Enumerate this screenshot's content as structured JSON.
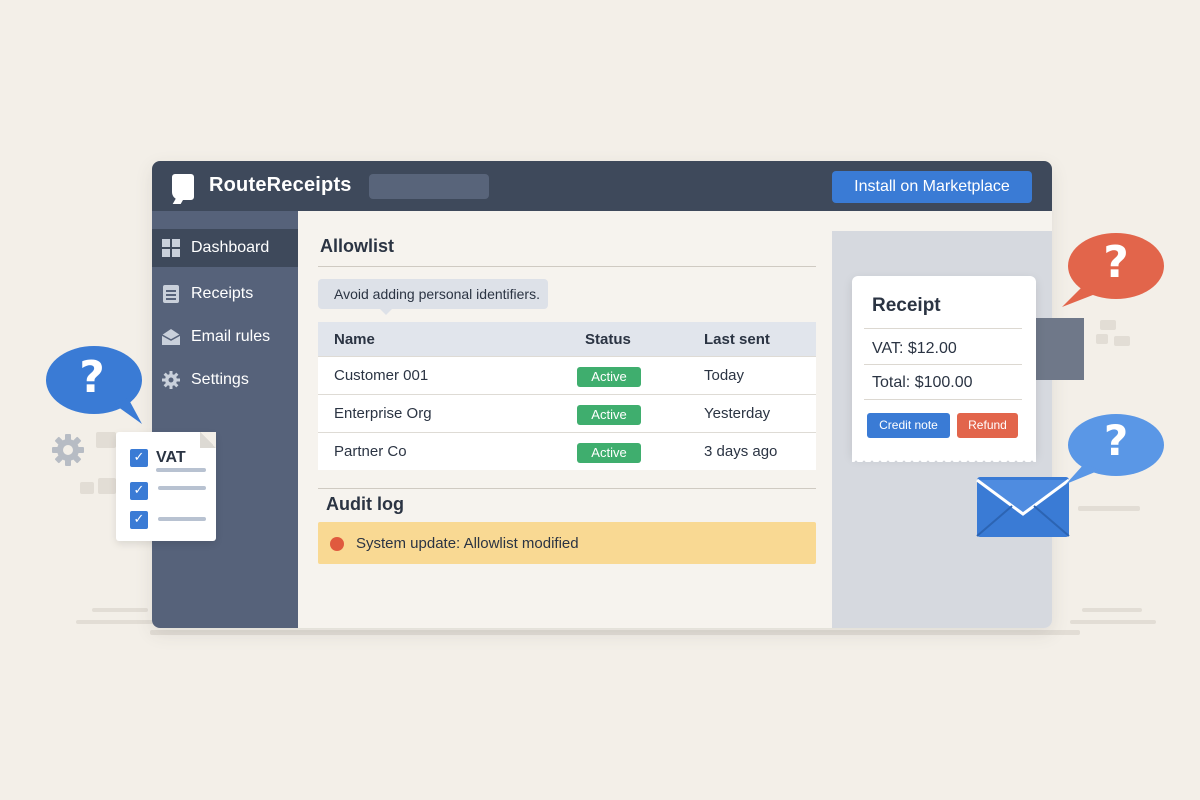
{
  "app": {
    "title": "RouteReceipts",
    "install_label": "Install on Marketplace"
  },
  "sidebar": {
    "items": [
      {
        "label": "Dashboard",
        "icon": "grid-icon",
        "active": true
      },
      {
        "label": "Receipts",
        "icon": "document-icon",
        "active": false
      },
      {
        "label": "Email rules",
        "icon": "inbox-icon",
        "active": false
      },
      {
        "label": "Settings",
        "icon": "gear-icon",
        "active": false
      }
    ]
  },
  "allowlist": {
    "title": "Allowlist",
    "hint": "Avoid adding personal identifiers.",
    "columns": [
      "Name",
      "Status",
      "Last sent"
    ],
    "rows": [
      {
        "name": "Customer 001",
        "status": "Active",
        "last_sent": "Today"
      },
      {
        "name": "Enterprise Org",
        "status": "Active",
        "last_sent": "Yesterday"
      },
      {
        "name": "Partner Co",
        "status": "Active",
        "last_sent": "3 days ago"
      }
    ]
  },
  "audit": {
    "title": "Audit log",
    "entry": "System update: Allowlist modified"
  },
  "receipt": {
    "title": "Receipt",
    "vat": "VAT: $12.00",
    "total": "Total: $100.00",
    "credit_label": "Credit note",
    "refund_label": "Refund"
  },
  "checklist": {
    "label": "VAT"
  },
  "bubbles": [
    "?",
    "?",
    "?"
  ],
  "colors": {
    "topbar": "#3e495b",
    "sidebar": "#56627a",
    "accent_blue": "#3a7bd5",
    "status_green": "#3fae6e",
    "alert_yellow": "#f9d993",
    "alert_red": "#e05a3e",
    "refund_orange": "#e2654b"
  }
}
